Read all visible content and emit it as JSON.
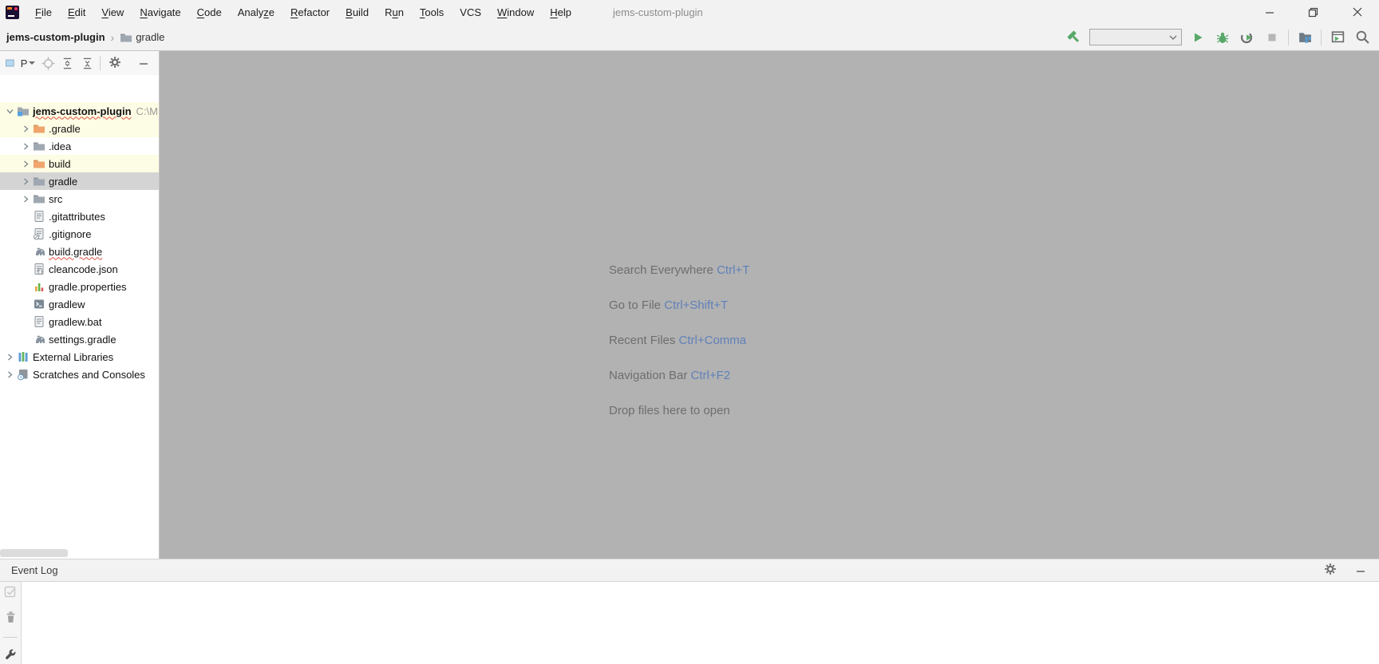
{
  "window": {
    "title": "jems-custom-plugin",
    "controls": {
      "minimize": "minimize",
      "restore": "restore",
      "close": "close"
    }
  },
  "menu": {
    "items": [
      {
        "label": "File",
        "underline": 0
      },
      {
        "label": "Edit",
        "underline": 0
      },
      {
        "label": "View",
        "underline": 0
      },
      {
        "label": "Navigate",
        "underline": 0
      },
      {
        "label": "Code",
        "underline": 0
      },
      {
        "label": "Analyze",
        "underline": 5
      },
      {
        "label": "Refactor",
        "underline": 0
      },
      {
        "label": "Build",
        "underline": 0
      },
      {
        "label": "Run",
        "underline": 1
      },
      {
        "label": "Tools",
        "underline": 0
      },
      {
        "label": "VCS",
        "underline": -1
      },
      {
        "label": "Window",
        "underline": 0
      },
      {
        "label": "Help",
        "underline": 0
      }
    ]
  },
  "breadcrumb": {
    "project": "jems-custom-plugin",
    "separator": "›",
    "item": "gradle"
  },
  "toolbar": {
    "run_config_value": ""
  },
  "project_panel": {
    "view_label": "P",
    "tree": [
      {
        "label": "jems-custom-plugin",
        "suffix": "C:\\M",
        "icon": "project-folder",
        "depth": 0,
        "chevron": "expanded",
        "bg": "yellow",
        "bold": true,
        "squiggle": true
      },
      {
        "label": ".gradle",
        "icon": "folder-excluded",
        "depth": 1,
        "chevron": "collapsed",
        "bg": "yellow"
      },
      {
        "label": ".idea",
        "icon": "folder",
        "depth": 1,
        "chevron": "collapsed",
        "bg": "white"
      },
      {
        "label": "build",
        "icon": "folder-excluded",
        "depth": 1,
        "chevron": "collapsed",
        "bg": "yellow"
      },
      {
        "label": "gradle",
        "icon": "folder",
        "depth": 1,
        "chevron": "collapsed",
        "bg": "selected"
      },
      {
        "label": "src",
        "icon": "folder",
        "depth": 1,
        "chevron": "collapsed",
        "bg": "white"
      },
      {
        "label": ".gitattributes",
        "icon": "text-file",
        "depth": 1,
        "bg": "white"
      },
      {
        "label": ".gitignore",
        "icon": "ignored-file",
        "depth": 1,
        "bg": "white"
      },
      {
        "label": "build.gradle",
        "icon": "gradle-file",
        "depth": 1,
        "bg": "white",
        "squiggle": true
      },
      {
        "label": "cleancode.json",
        "icon": "json-file",
        "depth": 1,
        "bg": "white"
      },
      {
        "label": "gradle.properties",
        "icon": "properties-file",
        "depth": 1,
        "bg": "white"
      },
      {
        "label": "gradlew",
        "icon": "shell-file",
        "depth": 1,
        "bg": "white"
      },
      {
        "label": "gradlew.bat",
        "icon": "text-file",
        "depth": 1,
        "bg": "white"
      },
      {
        "label": "settings.gradle",
        "icon": "gradle-file",
        "depth": 1,
        "bg": "white"
      },
      {
        "label": "External Libraries",
        "icon": "libraries",
        "depth": 0,
        "chevron": "collapsed",
        "bg": "white"
      },
      {
        "label": "Scratches and Consoles",
        "icon": "scratches",
        "depth": 0,
        "chevron": "collapsed",
        "bg": "white"
      }
    ]
  },
  "editor": {
    "hints": [
      {
        "label": "Search Everywhere",
        "shortcut": "Ctrl+T"
      },
      {
        "label": "Go to File",
        "shortcut": "Ctrl+Shift+T"
      },
      {
        "label": "Recent Files",
        "shortcut": "Ctrl+Comma"
      },
      {
        "label": "Navigation Bar",
        "shortcut": "Ctrl+F2"
      },
      {
        "label": "Drop files here to open",
        "shortcut": ""
      }
    ]
  },
  "event_log": {
    "title": "Event Log"
  },
  "colors": {
    "accent_green": "#59a869",
    "folder_orange": "#efa56b",
    "folder_gray": "#9fa8b0",
    "blue_accent": "#3f8ecc",
    "selection_gray": "#d4d4d4",
    "highlight_yellow": "#fdfce4",
    "editor_background": "#b2b2b2",
    "hint_label": "#6e6e6e",
    "hint_shortcut": "#6080b8",
    "bar_background": "#f2f2f2",
    "error_red": "#e0513e"
  }
}
